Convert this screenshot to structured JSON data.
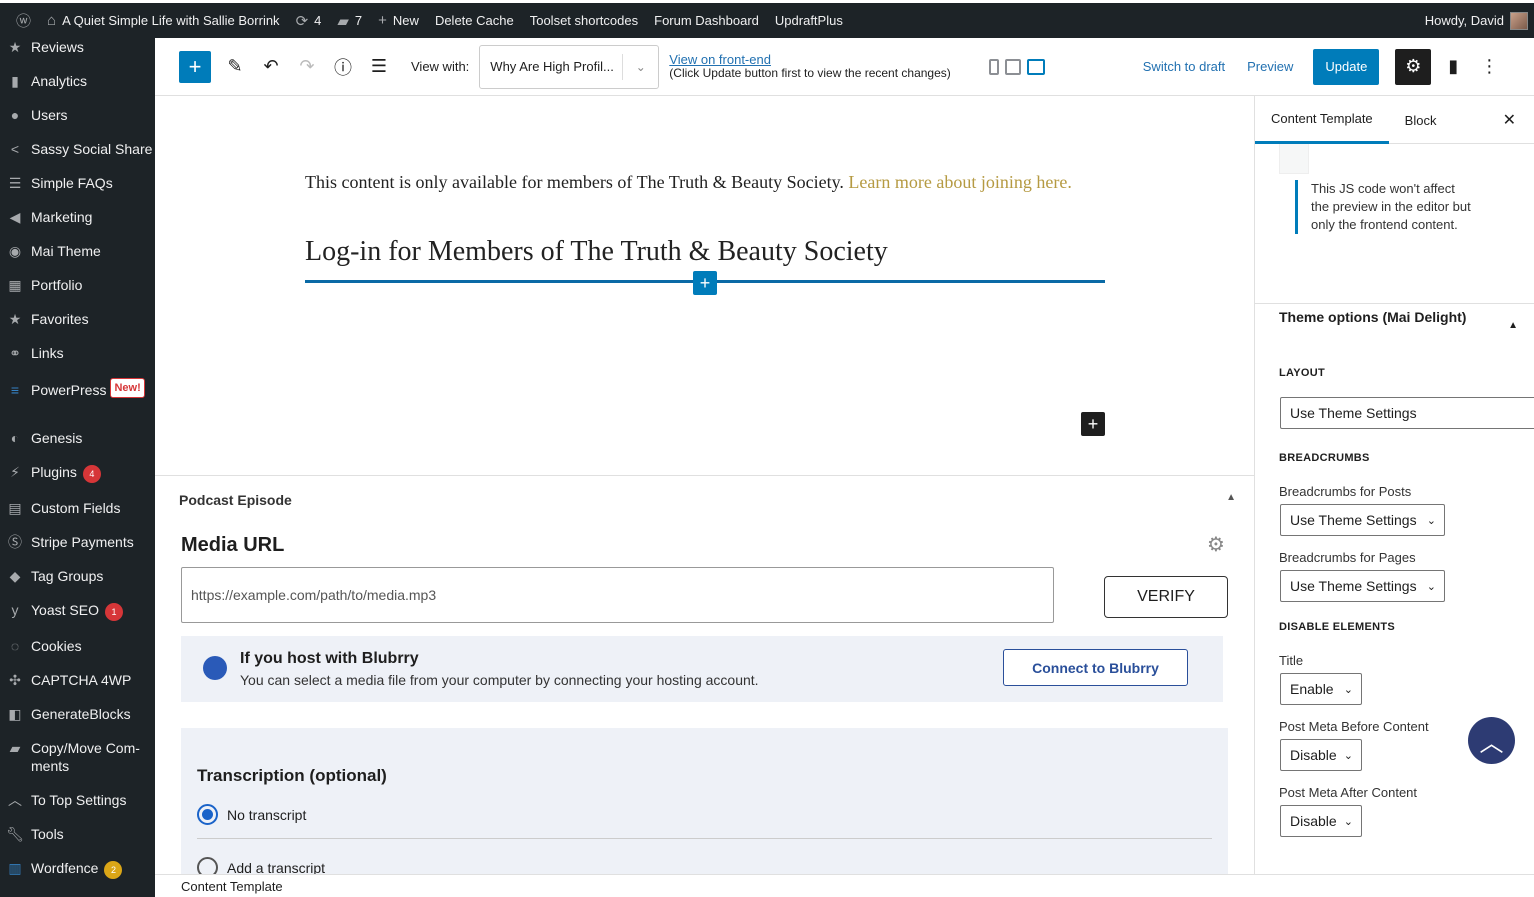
{
  "adminbar": {
    "site_name": "A Quiet Simple Life with Sallie Borrink",
    "updates_count": "4",
    "comments_count": "7",
    "new_label": "New",
    "links": [
      "Delete Cache",
      "Toolset shortcodes",
      "Forum Dashboard",
      "UpdraftPlus"
    ],
    "greeting": "Howdy, David"
  },
  "sidebar": {
    "items": [
      {
        "label": "Reviews",
        "icon": "star-icon"
      },
      {
        "label": "Analytics",
        "icon": "bar-chart-icon"
      },
      {
        "label": "Users",
        "icon": "user-icon"
      },
      {
        "label": "Sassy Social Share",
        "icon": "share-icon"
      },
      {
        "label": "Simple FAQs",
        "icon": "list-icon"
      },
      {
        "label": "Marketing",
        "icon": "megaphone-icon"
      },
      {
        "label": "Mai Theme",
        "icon": "mai-icon"
      },
      {
        "label": "Portfolio",
        "icon": "portfolio-icon"
      },
      {
        "label": "Favorites",
        "icon": "star-icon"
      },
      {
        "label": "Links",
        "icon": "link-icon"
      },
      {
        "label": "PowerPress",
        "icon": "powerpress-icon",
        "new": "New!"
      },
      {
        "label": "Genesis",
        "icon": "genesis-icon"
      },
      {
        "label": "Plugins",
        "icon": "plug-icon",
        "badge": "4"
      },
      {
        "label": "Custom Fields",
        "icon": "grid-icon"
      },
      {
        "label": "Stripe Payments",
        "icon": "stripe-icon"
      },
      {
        "label": "Tag Groups",
        "icon": "tag-icon"
      },
      {
        "label": "Yoast SEO",
        "icon": "yoast-icon",
        "badge": "1"
      },
      {
        "label": "Cookies",
        "icon": "cookie-icon"
      },
      {
        "label": "CAPTCHA 4WP",
        "icon": "captcha-icon"
      },
      {
        "label": "GenerateBlocks",
        "icon": "blocks-icon"
      },
      {
        "label": "Copy/Move Com- ments",
        "icon": "comments-icon"
      },
      {
        "label": "To Top Settings",
        "icon": "chevron-up-icon"
      },
      {
        "label": "Tools",
        "icon": "wrench-icon"
      },
      {
        "label": "Wordfence",
        "icon": "wordfence-icon",
        "badge": "2"
      }
    ]
  },
  "toolbar": {
    "view_with_label": "View with:",
    "view_with_value": "Why Are High Profil...",
    "frontend_link": "View on front-end",
    "frontend_note": "(Click Update button first to view the recent changes)",
    "switch_draft": "Switch to draft",
    "preview": "Preview",
    "update": "Update"
  },
  "content": {
    "notice": "This content is only available for members of The Truth & Beauty Society.",
    "notice_link": "Learn more about joining here.",
    "heading": "Log-in for Members of The Truth & Beauty Society"
  },
  "metabox": {
    "title": "Podcast Episode",
    "media_url_label": "Media URL",
    "media_placeholder": "https://example.com/path/to/media.mp3",
    "verify": "VERIFY",
    "blubrry_title": "If you host with Blubrry",
    "blubrry_desc": "You can select a media file from your computer by connecting your hosting account.",
    "blubrry_button": "Connect to Blubrry",
    "transcription_title": "Transcription (optional)",
    "radio_no": "No transcript",
    "radio_add": "Add a transcript"
  },
  "footer": {
    "breadcrumb": "Content Template"
  },
  "panel": {
    "tab_template": "Content Template",
    "tab_block": "Block",
    "js_note": "This JS code won't affect the preview in the editor but only the frontend content.",
    "theme_title": "Theme options (Mai Delight)",
    "layout_heading": "LAYOUT",
    "layout_value": "Use Theme Settings",
    "breadcrumbs_heading": "BREADCRUMBS",
    "bc_posts_label": "Breadcrumbs for Posts",
    "bc_posts_value": "Use Theme Settings",
    "bc_pages_label": "Breadcrumbs for Pages",
    "bc_pages_value": "Use Theme Settings",
    "disable_heading": "DISABLE ELEMENTS",
    "title_label": "Title",
    "title_value": "Enable",
    "meta_before_label": "Post Meta Before Content",
    "meta_before_value": "Disable",
    "meta_after_label": "Post Meta After Content",
    "meta_after_value": "Disable"
  },
  "colors": {
    "accent": "#007cba",
    "admin_dark": "#1d2327",
    "link_gold": "#b59a42",
    "badge_red": "#d63638",
    "badge_orange": "#dba617"
  }
}
